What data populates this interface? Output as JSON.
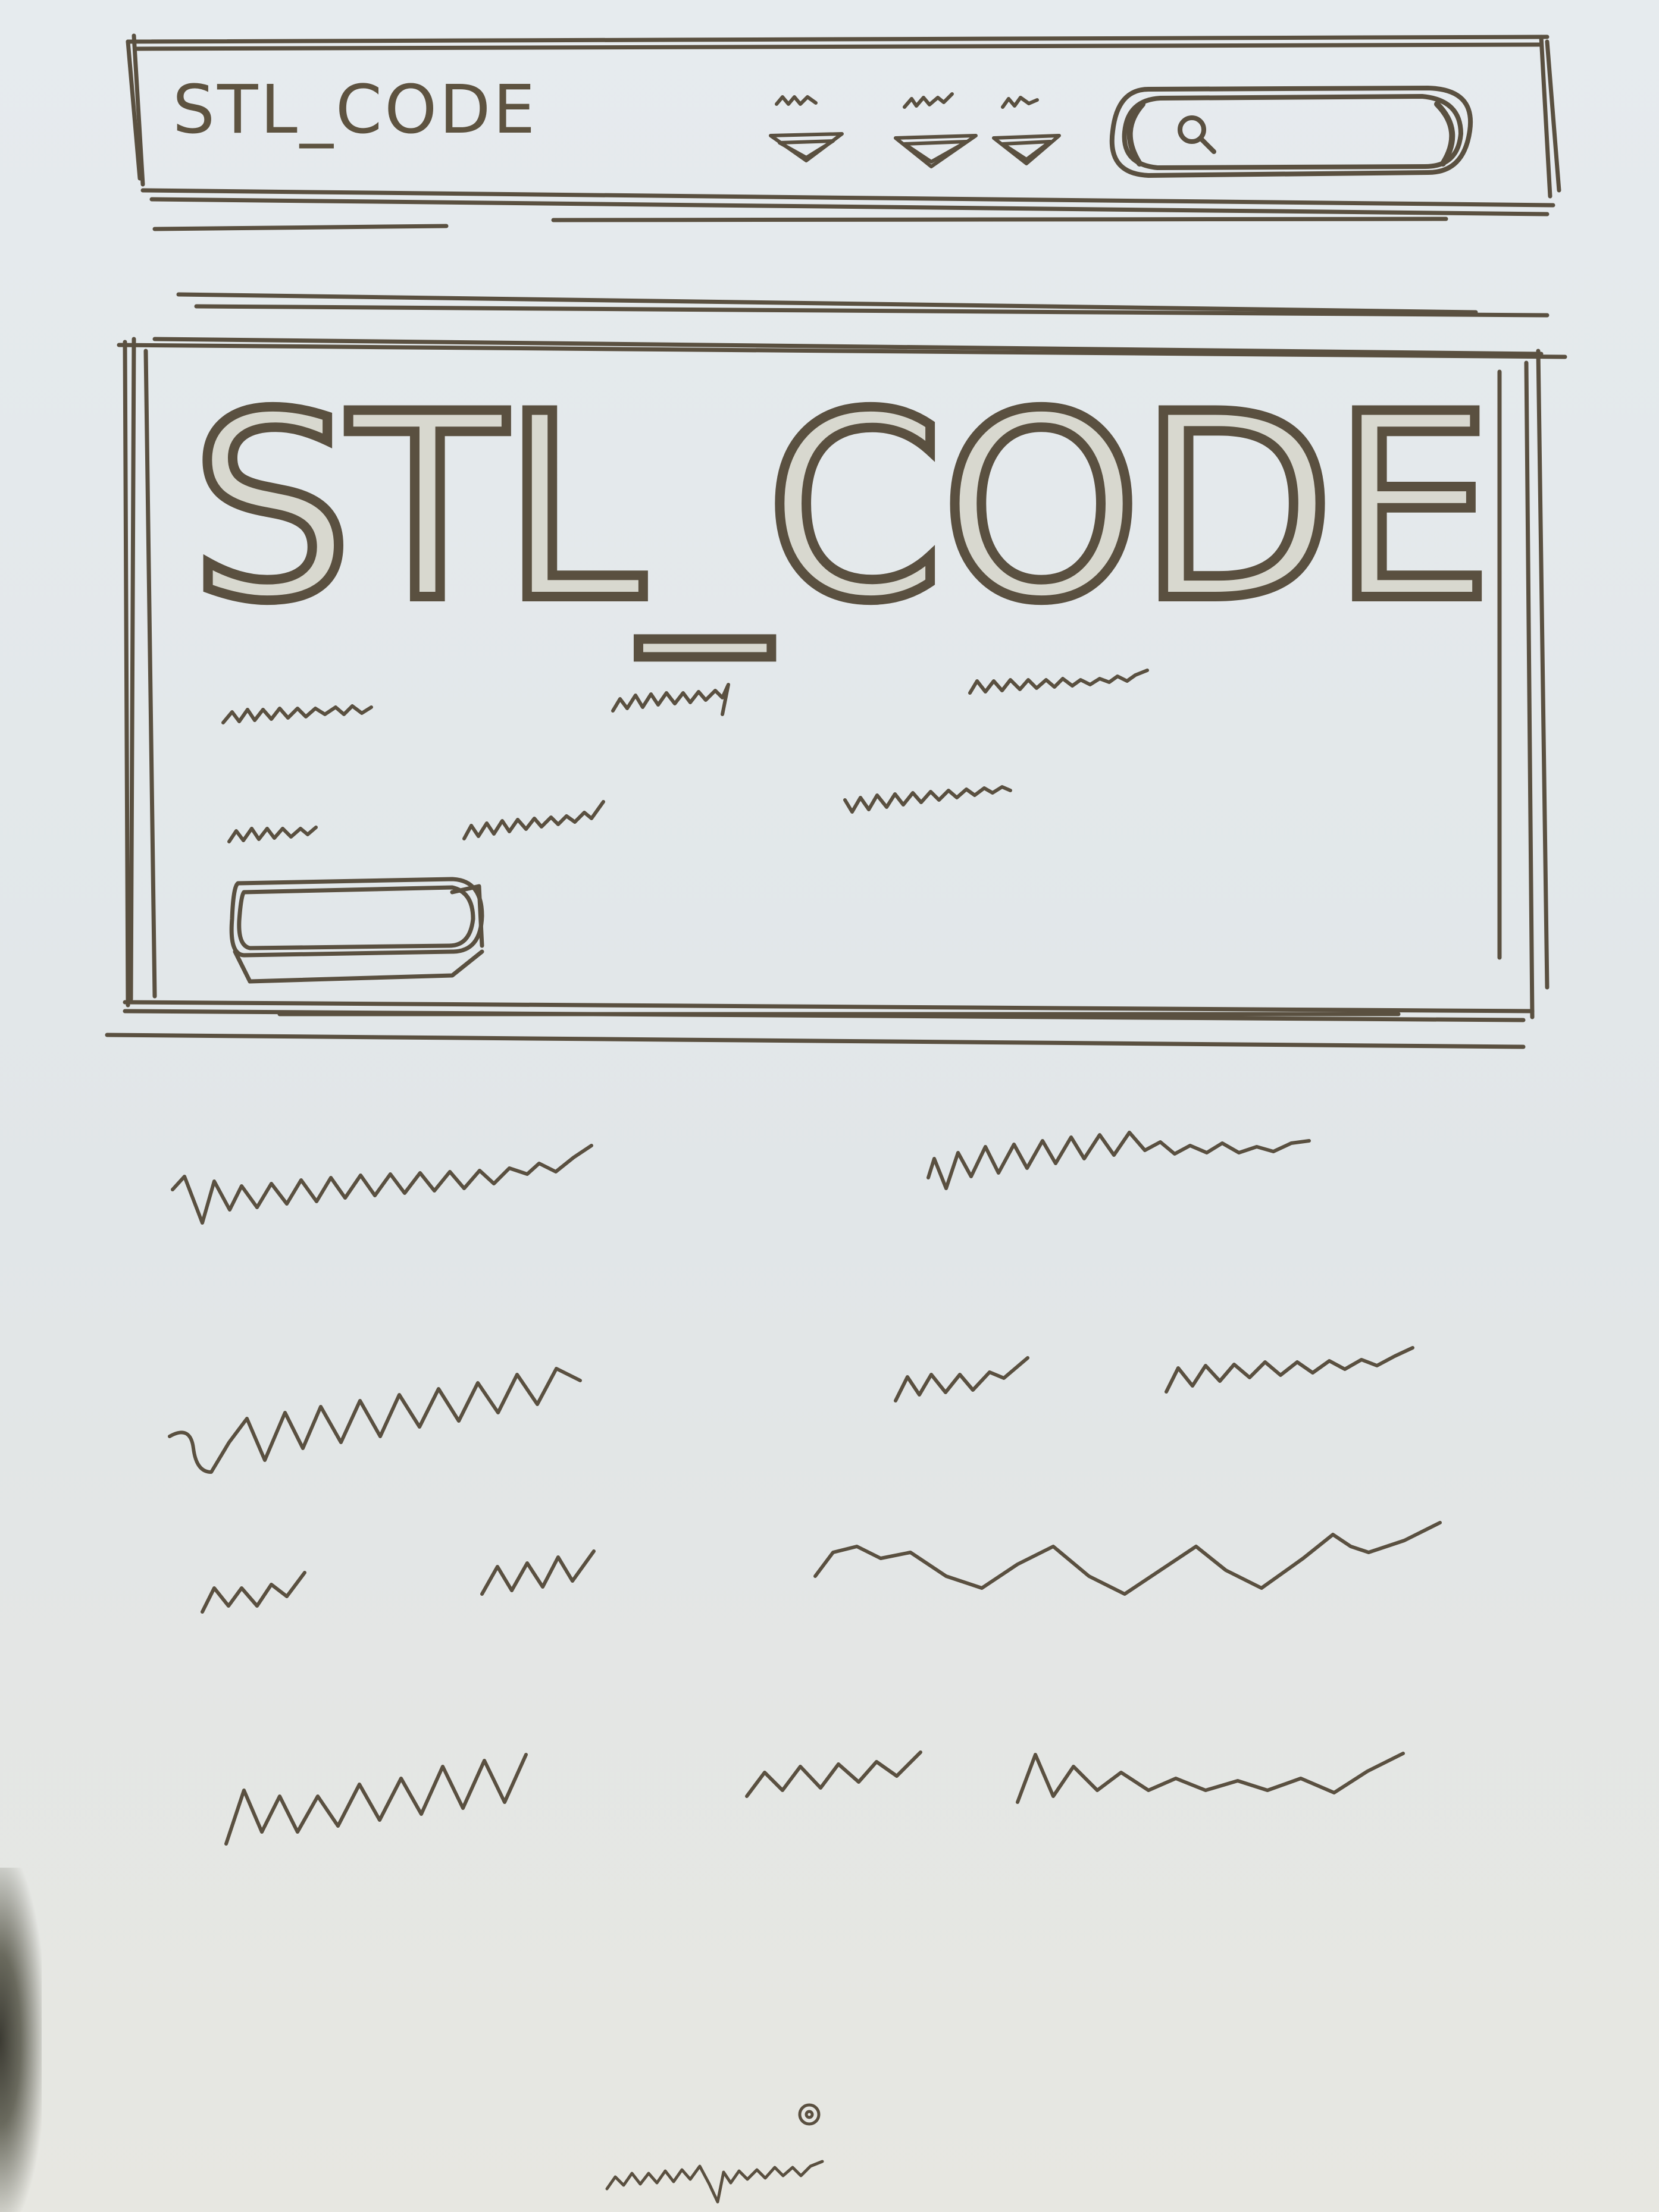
{
  "navbar": {
    "logo": "STL_CODE",
    "menu_items": [
      {
        "label": "",
        "icon": "chevron-down-icon"
      },
      {
        "label": "",
        "icon": "chevron-down-icon"
      },
      {
        "label": "",
        "icon": "chevron-down-icon"
      }
    ],
    "search": {
      "icon": "search-icon",
      "placeholder": ""
    }
  },
  "hero": {
    "title": "STL_CODE",
    "button_label": ""
  },
  "colors": {
    "paper": "#e3e8ea",
    "pencil": "#5a5040"
  }
}
